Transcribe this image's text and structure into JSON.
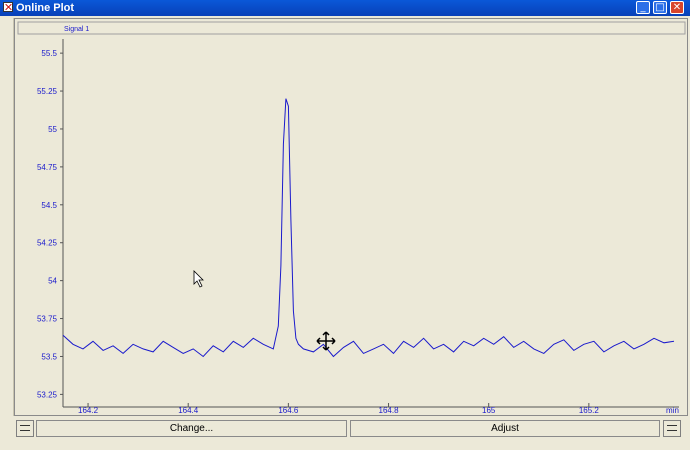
{
  "window": {
    "title": "Online Plot"
  },
  "window_buttons": [
    "_",
    "□",
    "✕"
  ],
  "plot": {
    "signal_label": "Signal 1",
    "x_unit_label": "min",
    "line_color": "#1a1acc",
    "tick_color": "#1a1acc"
  },
  "buttons": {
    "change": "Change...",
    "adjust": "Adjust"
  },
  "chart_data": {
    "type": "line",
    "title": "",
    "xlabel": "min",
    "ylabel": "",
    "xlim": [
      164.15,
      165.38
    ],
    "ylim": [
      53.18,
      55.58
    ],
    "x_ticks": [
      {
        "value": 164.2,
        "label": "164.2"
      },
      {
        "value": 164.4,
        "label": "164.4"
      },
      {
        "value": 164.6,
        "label": "164.6"
      },
      {
        "value": 164.8,
        "label": "164.8"
      },
      {
        "value": 165.0,
        "label": "165"
      },
      {
        "value": 165.2,
        "label": "165.2"
      }
    ],
    "y_ticks": [
      {
        "value": 53.25,
        "label": "53.25"
      },
      {
        "value": 53.5,
        "label": "53.5"
      },
      {
        "value": 53.75,
        "label": "53.75"
      },
      {
        "value": 54.0,
        "label": "54"
      },
      {
        "value": 54.25,
        "label": "54.25"
      },
      {
        "value": 54.5,
        "label": "54.5"
      },
      {
        "value": 54.75,
        "label": "54.75"
      },
      {
        "value": 55.0,
        "label": "55"
      },
      {
        "value": 55.25,
        "label": "55.25"
      },
      {
        "value": 55.5,
        "label": "55.5"
      }
    ],
    "series": [
      {
        "x": [
          164.15,
          164.17,
          164.19,
          164.21,
          164.23,
          164.25,
          164.27,
          164.29,
          164.31,
          164.33,
          164.35,
          164.37,
          164.39,
          164.41,
          164.43,
          164.45,
          164.47,
          164.49,
          164.51,
          164.53,
          164.55,
          164.57,
          164.58,
          164.585,
          164.59,
          164.595,
          164.6,
          164.605,
          164.61,
          164.615,
          164.62,
          164.63,
          164.65,
          164.67,
          164.69,
          164.71,
          164.73,
          164.75,
          164.77,
          164.79,
          164.81,
          164.83,
          164.85,
          164.87,
          164.89,
          164.91,
          164.93,
          164.95,
          164.97,
          164.99,
          165.01,
          165.03,
          165.05,
          165.07,
          165.09,
          165.11,
          165.13,
          165.15,
          165.17,
          165.19,
          165.21,
          165.23,
          165.25,
          165.27,
          165.29,
          165.31,
          165.33,
          165.35,
          165.37
        ],
        "y": [
          53.64,
          53.58,
          53.55,
          53.6,
          53.54,
          53.57,
          53.52,
          53.58,
          53.55,
          53.53,
          53.6,
          53.56,
          53.52,
          53.55,
          53.5,
          53.57,
          53.53,
          53.6,
          53.56,
          53.62,
          53.58,
          53.55,
          53.7,
          54.1,
          54.9,
          55.2,
          55.15,
          54.4,
          53.8,
          53.62,
          53.58,
          53.55,
          53.53,
          53.58,
          53.5,
          53.56,
          53.6,
          53.52,
          53.55,
          53.58,
          53.52,
          53.6,
          53.56,
          53.62,
          53.55,
          53.58,
          53.53,
          53.6,
          53.57,
          53.62,
          53.58,
          53.63,
          53.56,
          53.6,
          53.55,
          53.52,
          53.58,
          53.61,
          53.54,
          53.58,
          53.6,
          53.53,
          53.57,
          53.6,
          53.55,
          53.58,
          53.62,
          53.59,
          53.6
        ]
      }
    ]
  }
}
